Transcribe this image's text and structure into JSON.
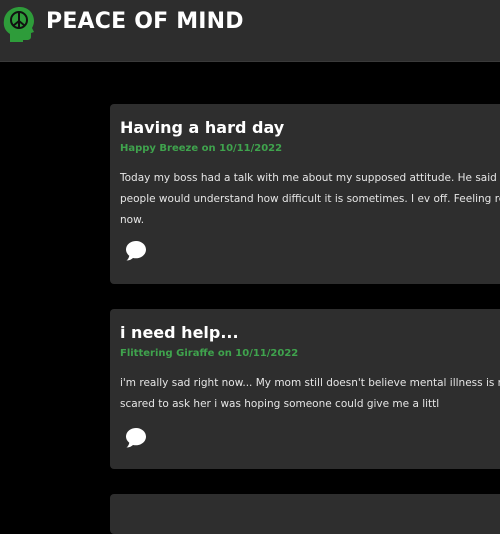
{
  "header": {
    "brand": "PEACE OF MIND",
    "logo_icon": "head-peace-icon",
    "logo_color": "#2e9c3a"
  },
  "posts": [
    {
      "title": "Having a hard day",
      "meta": "Happy Breeze on 10/11/2022",
      "body": "Today my boss had a talk with me about my supposed attitude. He said that I Second, I just wish people would understand how difficult it is sometimes. I ev off. Feeling really down about me right now.",
      "comment_icon": "comment-icon"
    },
    {
      "title": "i need help...",
      "meta": "Flittering Giraffe on 10/11/2022",
      "body": "i'm really sad right now... My mom still doesn't believe mental illness is real... St therapist but i'm scared to ask her i was hoping someone could give me a littl",
      "comment_icon": "comment-icon"
    }
  ],
  "colors": {
    "background": "#000000",
    "topbar": "#2d2d2d",
    "card": "#2e2e2e",
    "meta_green": "#3fa34d",
    "text": "#e6e6e6"
  }
}
